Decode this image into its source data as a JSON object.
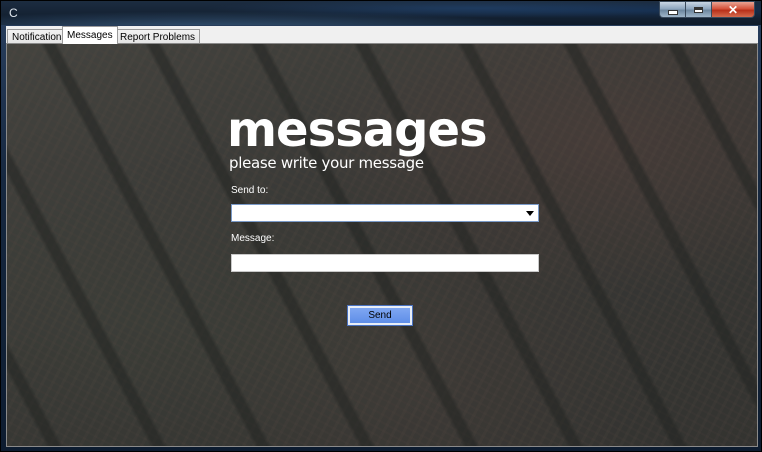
{
  "window": {
    "title": "C",
    "controls": {
      "minimize": "",
      "maximize": "",
      "close": "✕"
    }
  },
  "tabs": [
    {
      "label": "Notifications",
      "active": false
    },
    {
      "label": "Messages",
      "active": true
    },
    {
      "label": "Report Problems",
      "active": false
    }
  ],
  "messages_panel": {
    "heading": "messages",
    "subheading": "please write your message",
    "send_to_label": "Send to:",
    "send_to_value": "",
    "message_label": "Message:",
    "message_value": "",
    "send_button": "Send"
  },
  "colors": {
    "send_button": "#6a96ec",
    "close_button": "#d4523b"
  }
}
